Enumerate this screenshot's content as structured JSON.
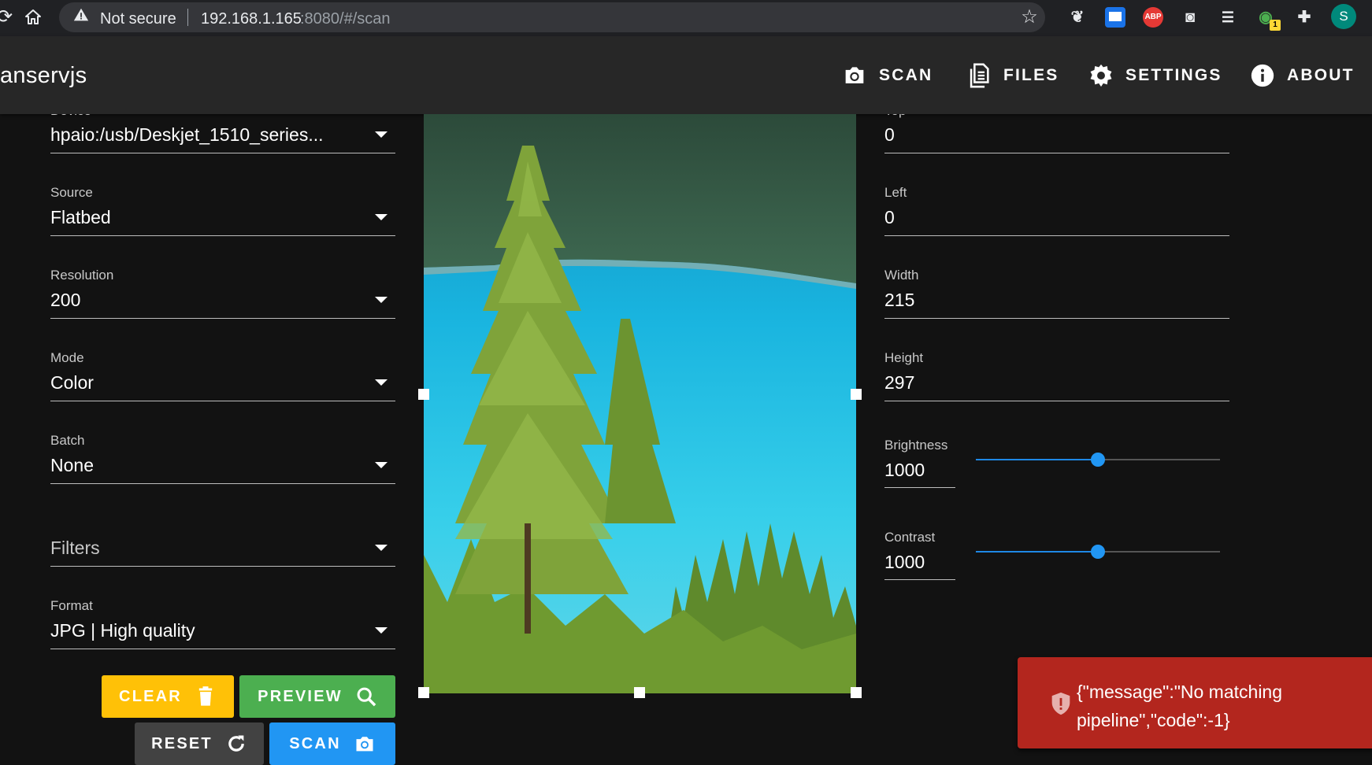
{
  "browser": {
    "security_label": "Not secure",
    "url_host": "192.168.1.165",
    "url_rest": ":8080/#/scan",
    "profile_initial": "S",
    "ext_abp": "ABP",
    "ext_badge": "1"
  },
  "app": {
    "brand": "anservjs",
    "nav": {
      "scan": "SCAN",
      "files": "FILES",
      "settings": "SETTINGS",
      "about": "ABOUT"
    }
  },
  "form": {
    "device": {
      "label": "Device",
      "value": "hpaio:/usb/Deskjet_1510_series..."
    },
    "source": {
      "label": "Source",
      "value": "Flatbed"
    },
    "resolution": {
      "label": "Resolution",
      "value": "200"
    },
    "mode": {
      "label": "Mode",
      "value": "Color"
    },
    "batch": {
      "label": "Batch",
      "value": "None"
    },
    "filters": {
      "placeholder": "Filters"
    },
    "format": {
      "label": "Format",
      "value": "JPG | High quality"
    }
  },
  "buttons": {
    "clear": "CLEAR",
    "preview": "PREVIEW",
    "reset": "RESET",
    "scan": "SCAN"
  },
  "geometry_fields": {
    "top": {
      "label": "Top",
      "value": "0"
    },
    "left": {
      "label": "Left",
      "value": "0"
    },
    "width": {
      "label": "Width",
      "value": "215"
    },
    "height": {
      "label": "Height",
      "value": "297"
    }
  },
  "adjust": {
    "brightness": {
      "label": "Brightness",
      "value": "1000",
      "slider_fraction": 0.5
    },
    "contrast": {
      "label": "Contrast",
      "value": "1000",
      "slider_fraction": 0.5
    }
  },
  "error": {
    "message": "{\"message\":\"No matching pipeline\",\"code\":-1}"
  },
  "colors": {
    "clear_button": "#ffc107",
    "preview_button": "#4caf50",
    "reset_button": "#424242",
    "scan_button": "#2196f3",
    "error": "#b3261e",
    "accent": "#2196f3"
  }
}
